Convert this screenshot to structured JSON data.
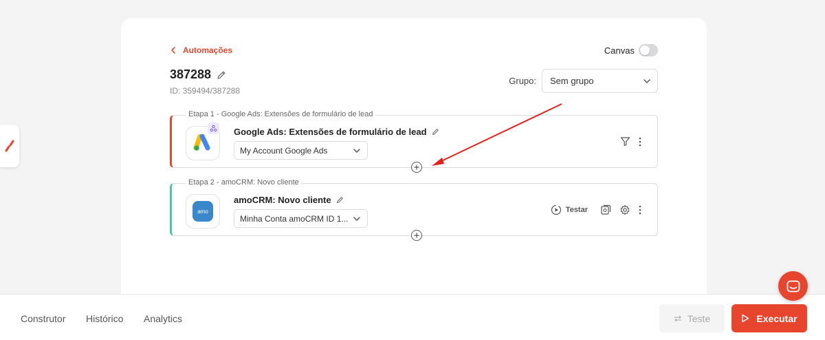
{
  "nav": {
    "back_label": "Automações"
  },
  "canvas": {
    "label": "Canvas",
    "enabled": false
  },
  "automation": {
    "title": "387288",
    "id_label": "ID: 359494/387288"
  },
  "group": {
    "label": "Grupo:",
    "selected": "Sem grupo"
  },
  "steps": [
    {
      "label": "Etapa 1 - Google Ads: Extensões de formulário de lead",
      "name": "Google Ads: Extensões de formulário de lead",
      "account": "My Account Google Ads",
      "icon": "google-ads-icon",
      "accent": "#e8452f"
    },
    {
      "label": "Etapa 2 - amoCRM: Novo cliente",
      "name": "amoCRM: Novo cliente",
      "account": "Minha Conta amoCRM ID 1...",
      "icon": "amocrm-icon",
      "accent": "#4cc7a2",
      "test_label": "Testar"
    }
  ],
  "footer": {
    "tabs": [
      "Construtor",
      "Histórico",
      "Analytics"
    ],
    "test_button": "Teste",
    "run_button": "Executar"
  },
  "colors": {
    "accent": "#e8452f",
    "step2": "#4cc7a2",
    "amocrm": "#3a87c9"
  }
}
